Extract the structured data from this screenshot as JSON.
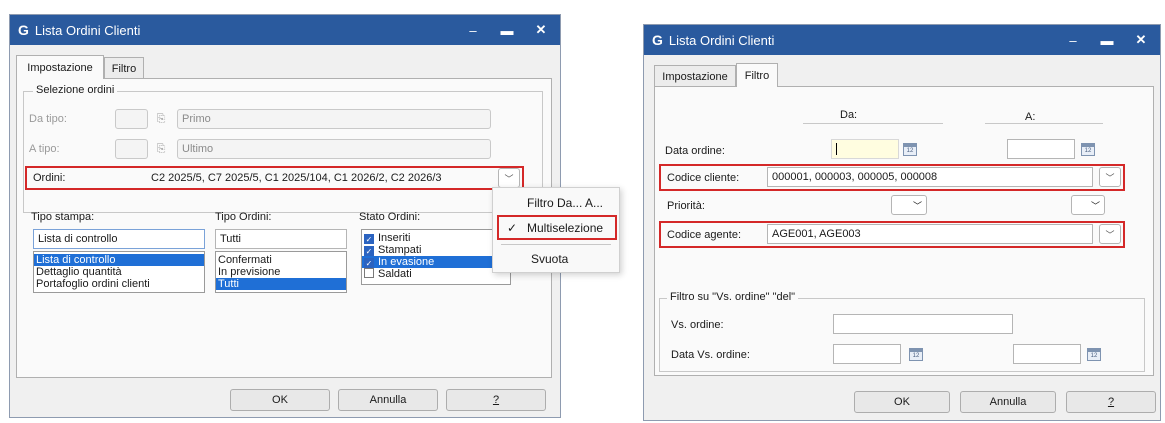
{
  "left_window": {
    "title": "Lista Ordini Clienti",
    "logo": "G",
    "tabs": [
      "Impostazione",
      "Filtro"
    ],
    "selezione_title": "Selezione ordini",
    "da_tipo_label": "Da tipo:",
    "da_tipo_value": "Primo",
    "a_tipo_label": "A tipo:",
    "a_tipo_value": "Ultimo",
    "ordini_label": "Ordini:",
    "ordini_value": "C2 2025/5, C7 2025/5, C1 2025/104, C1 2026/2, C2 2026/3",
    "tipo_stampa_label": "Tipo stampa:",
    "tipo_stampa_value": "Lista di controllo",
    "tipo_stampa_options": [
      "Lista di controllo",
      "Dettaglio quantità",
      "Portafoglio ordini clienti"
    ],
    "tipo_ordini_label": "Tipo Ordini:",
    "tipo_ordini_value": "Tutti",
    "tipo_ordini_options": [
      "Confermati",
      "In previsione",
      "Tutti"
    ],
    "stato_label": "Stato Ordini:",
    "stato_options": [
      {
        "label": "Inseriti",
        "checked": true
      },
      {
        "label": "Stampati",
        "checked": true
      },
      {
        "label": "In evasione",
        "checked": true
      },
      {
        "label": "Saldati",
        "checked": false
      }
    ],
    "menu": {
      "items": [
        "Filtro Da... A...",
        "Multiselezione",
        "Svuota"
      ],
      "checked_index": 1
    },
    "buttons": {
      "ok": "OK",
      "annulla": "Annulla",
      "help": "?"
    }
  },
  "right_window": {
    "title": "Lista Ordini Clienti",
    "logo": "G",
    "tabs": [
      "Impostazione",
      "Filtro"
    ],
    "da_header": "Da:",
    "a_header": "A:",
    "data_ordine_label": "Data ordine:",
    "codice_cliente_label": "Codice cliente:",
    "codice_cliente_value": "000001, 000003, 000005, 000008",
    "priorita_label": "Priorità:",
    "codice_agente_label": "Codice agente:",
    "codice_agente_value": "AGE001, AGE003",
    "vs_group_title": "Filtro su \"Vs. ordine\" \"del\"",
    "vs_ordine_label": "Vs. ordine:",
    "data_vs_label": "Data Vs. ordine:",
    "buttons": {
      "ok": "OK",
      "annulla": "Annulla",
      "help": "?"
    }
  },
  "colors": {
    "titlebar": "#2a5a9e",
    "highlight": "#d42828",
    "selection": "#1f6fd6"
  }
}
